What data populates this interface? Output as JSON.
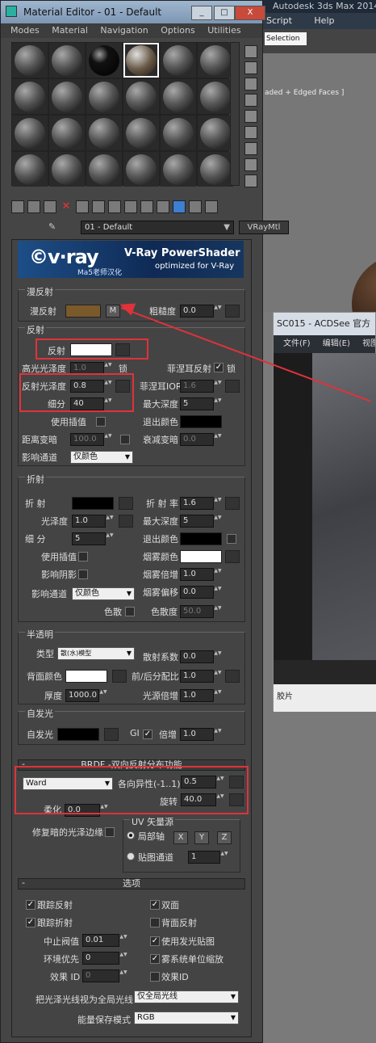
{
  "app": {
    "title": "Autodesk 3ds Max  2014",
    "menu": [
      "Script",
      "Help"
    ],
    "selection": "Selection Se",
    "viewport_label": "aded + Edged Faces ]"
  },
  "acdsee": {
    "title": "SC015 - ACDSee 官方",
    "menu": [
      "文件(F)",
      "编辑(E)",
      "视图("
    ],
    "status": "胶片"
  },
  "editor": {
    "title": "Material Editor - 01 - Default",
    "window_buttons": [
      "_",
      "□",
      "X"
    ],
    "menu": [
      "Modes",
      "Material",
      "Navigation",
      "Options",
      "Utilities"
    ],
    "material_name": "01 - Default",
    "material_type": "VRayMtl"
  },
  "banner": {
    "logo": "©v·ray",
    "subtitle": "Ma5老师汉化",
    "title": "V-Ray PowerShader",
    "tagline": "optimized for V-Ray"
  },
  "diffuse": {
    "group": "漫反射",
    "label": "漫反射",
    "map_button": "M",
    "colors": {
      "diffuse": "#7a5a2a"
    },
    "roughness_label": "粗糙度",
    "roughness": "0.0"
  },
  "reflection": {
    "group": "反射",
    "label": "反射",
    "colors": {
      "reflect": "#ffffff",
      "exit": "#000000"
    },
    "hilight_label": "高光光泽度",
    "hilight": "1.0",
    "lock": "锁",
    "fresnel_label": "菲涅耳反射",
    "fresnel_lock": "锁",
    "gloss_label": "反射光泽度",
    "gloss": "0.8",
    "fresnel_ior_label": "菲涅耳IOR",
    "fresnel_ior": "1.6",
    "subdivs_label": "细分",
    "subdivs": "40",
    "max_depth_label": "最大深度",
    "max_depth": "5",
    "interp_label": "使用插值",
    "exit_label": "退出颜色",
    "dim_dist_label": "距离变暗",
    "dim_dist": "100.0",
    "dim_fall_label": "衰减变暗",
    "dim_fall": "0.0",
    "affect_label": "影响通道",
    "affect": "仅颜色"
  },
  "refraction": {
    "group": "折射",
    "label": "折  射",
    "colors": {
      "refract": "#000000",
      "exit": "#000000",
      "fog": "#ffffff"
    },
    "ior_label": "折 射 率",
    "ior": "1.6",
    "gloss_label": "光泽度",
    "gloss": "1.0",
    "max_depth_label": "最大深度",
    "max_depth": "5",
    "subdivs_label": "细  分",
    "subdivs": "5",
    "exit_label": "退出颜色",
    "interp_label": "使用插值",
    "fog_label": "烟雾颜色",
    "shadows_label": "影响阴影",
    "fog_mult_label": "烟雾倍增",
    "fog_mult": "1.0",
    "affect_label": "影响通道",
    "affect": "仅颜色",
    "fog_bias_label": "烟雾偏移",
    "fog_bias": "0.0",
    "disp_label": "色散",
    "abbe_label": "色散度",
    "abbe": "50.0"
  },
  "translucency": {
    "group": "半透明",
    "type_label": "类型",
    "type": "散(水)模型",
    "scatter_label": "散射系数",
    "scatter": "0.0",
    "back_label": "背面颜色",
    "colors": {
      "back": "#ffffff"
    },
    "fwd_label": "前/后分配比",
    "fwd": "1.0",
    "thick_label": "厚度",
    "thick": "1000.0",
    "light_label": "光源倍增",
    "light": "1.0"
  },
  "selfillum": {
    "group": "自发光",
    "label": "自发光",
    "colors": {
      "self": "#000000"
    },
    "gi_label": "GI",
    "mult_label": "倍增",
    "mult": "1.0"
  },
  "brdf": {
    "header": "BRDF -双向反射分布功能",
    "header_mark": "-",
    "type": "Ward",
    "aniso_label": "各向异性(-1..1)",
    "aniso": "0.5",
    "rot_label": "旋转",
    "rot": "40.0",
    "soft_label": "柔化",
    "soft": "0.0",
    "fix_label": "修复暗的光泽边缘",
    "uv_group": "UV 矢量源",
    "local_axis": "局部轴",
    "axes": [
      "X",
      "Y",
      "Z"
    ],
    "map_channel": "贴图通道",
    "channel": "1"
  },
  "options": {
    "header": "选项",
    "header_mark": "-",
    "trace_refl": "跟踪反射",
    "double_sided": "双面",
    "trace_refr": "跟踪折射",
    "reflect_back": "背面反射",
    "cutoff_label": "中止阀值",
    "cutoff": "0.01",
    "use_irr": "使用发光贴图",
    "env_label": "环境优先",
    "env": "0",
    "fog_units": "雾系统单位缩放",
    "effect_label": "效果 ID",
    "effect": "0",
    "effect_id": "效果ID",
    "gloss_gi_label": "把光泽光线视为全局光线",
    "gloss_gi": "仅全局光线",
    "energy_label": "能量保存模式",
    "energy": "RGB"
  }
}
